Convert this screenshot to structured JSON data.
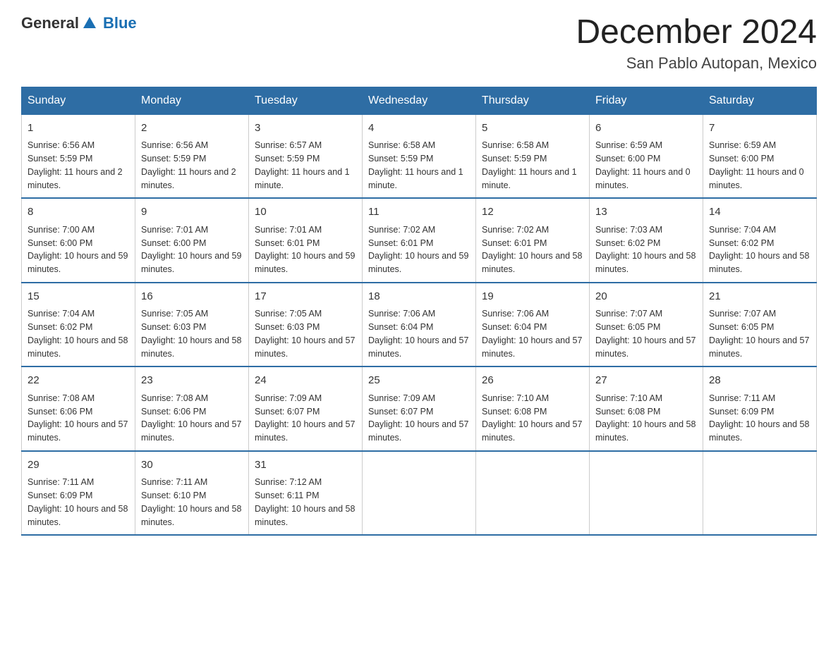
{
  "logo": {
    "text_general": "General",
    "text_blue": "Blue"
  },
  "header": {
    "title": "December 2024",
    "subtitle": "San Pablo Autopan, Mexico"
  },
  "days_of_week": [
    "Sunday",
    "Monday",
    "Tuesday",
    "Wednesday",
    "Thursday",
    "Friday",
    "Saturday"
  ],
  "weeks": [
    [
      {
        "day": "1",
        "sunrise": "6:56 AM",
        "sunset": "5:59 PM",
        "daylight": "11 hours and 2 minutes."
      },
      {
        "day": "2",
        "sunrise": "6:56 AM",
        "sunset": "5:59 PM",
        "daylight": "11 hours and 2 minutes."
      },
      {
        "day": "3",
        "sunrise": "6:57 AM",
        "sunset": "5:59 PM",
        "daylight": "11 hours and 1 minute."
      },
      {
        "day": "4",
        "sunrise": "6:58 AM",
        "sunset": "5:59 PM",
        "daylight": "11 hours and 1 minute."
      },
      {
        "day": "5",
        "sunrise": "6:58 AM",
        "sunset": "5:59 PM",
        "daylight": "11 hours and 1 minute."
      },
      {
        "day": "6",
        "sunrise": "6:59 AM",
        "sunset": "6:00 PM",
        "daylight": "11 hours and 0 minutes."
      },
      {
        "day": "7",
        "sunrise": "6:59 AM",
        "sunset": "6:00 PM",
        "daylight": "11 hours and 0 minutes."
      }
    ],
    [
      {
        "day": "8",
        "sunrise": "7:00 AM",
        "sunset": "6:00 PM",
        "daylight": "10 hours and 59 minutes."
      },
      {
        "day": "9",
        "sunrise": "7:01 AM",
        "sunset": "6:00 PM",
        "daylight": "10 hours and 59 minutes."
      },
      {
        "day": "10",
        "sunrise": "7:01 AM",
        "sunset": "6:01 PM",
        "daylight": "10 hours and 59 minutes."
      },
      {
        "day": "11",
        "sunrise": "7:02 AM",
        "sunset": "6:01 PM",
        "daylight": "10 hours and 59 minutes."
      },
      {
        "day": "12",
        "sunrise": "7:02 AM",
        "sunset": "6:01 PM",
        "daylight": "10 hours and 58 minutes."
      },
      {
        "day": "13",
        "sunrise": "7:03 AM",
        "sunset": "6:02 PM",
        "daylight": "10 hours and 58 minutes."
      },
      {
        "day": "14",
        "sunrise": "7:04 AM",
        "sunset": "6:02 PM",
        "daylight": "10 hours and 58 minutes."
      }
    ],
    [
      {
        "day": "15",
        "sunrise": "7:04 AM",
        "sunset": "6:02 PM",
        "daylight": "10 hours and 58 minutes."
      },
      {
        "day": "16",
        "sunrise": "7:05 AM",
        "sunset": "6:03 PM",
        "daylight": "10 hours and 58 minutes."
      },
      {
        "day": "17",
        "sunrise": "7:05 AM",
        "sunset": "6:03 PM",
        "daylight": "10 hours and 57 minutes."
      },
      {
        "day": "18",
        "sunrise": "7:06 AM",
        "sunset": "6:04 PM",
        "daylight": "10 hours and 57 minutes."
      },
      {
        "day": "19",
        "sunrise": "7:06 AM",
        "sunset": "6:04 PM",
        "daylight": "10 hours and 57 minutes."
      },
      {
        "day": "20",
        "sunrise": "7:07 AM",
        "sunset": "6:05 PM",
        "daylight": "10 hours and 57 minutes."
      },
      {
        "day": "21",
        "sunrise": "7:07 AM",
        "sunset": "6:05 PM",
        "daylight": "10 hours and 57 minutes."
      }
    ],
    [
      {
        "day": "22",
        "sunrise": "7:08 AM",
        "sunset": "6:06 PM",
        "daylight": "10 hours and 57 minutes."
      },
      {
        "day": "23",
        "sunrise": "7:08 AM",
        "sunset": "6:06 PM",
        "daylight": "10 hours and 57 minutes."
      },
      {
        "day": "24",
        "sunrise": "7:09 AM",
        "sunset": "6:07 PM",
        "daylight": "10 hours and 57 minutes."
      },
      {
        "day": "25",
        "sunrise": "7:09 AM",
        "sunset": "6:07 PM",
        "daylight": "10 hours and 57 minutes."
      },
      {
        "day": "26",
        "sunrise": "7:10 AM",
        "sunset": "6:08 PM",
        "daylight": "10 hours and 57 minutes."
      },
      {
        "day": "27",
        "sunrise": "7:10 AM",
        "sunset": "6:08 PM",
        "daylight": "10 hours and 58 minutes."
      },
      {
        "day": "28",
        "sunrise": "7:11 AM",
        "sunset": "6:09 PM",
        "daylight": "10 hours and 58 minutes."
      }
    ],
    [
      {
        "day": "29",
        "sunrise": "7:11 AM",
        "sunset": "6:09 PM",
        "daylight": "10 hours and 58 minutes."
      },
      {
        "day": "30",
        "sunrise": "7:11 AM",
        "sunset": "6:10 PM",
        "daylight": "10 hours and 58 minutes."
      },
      {
        "day": "31",
        "sunrise": "7:12 AM",
        "sunset": "6:11 PM",
        "daylight": "10 hours and 58 minutes."
      },
      null,
      null,
      null,
      null
    ]
  ]
}
